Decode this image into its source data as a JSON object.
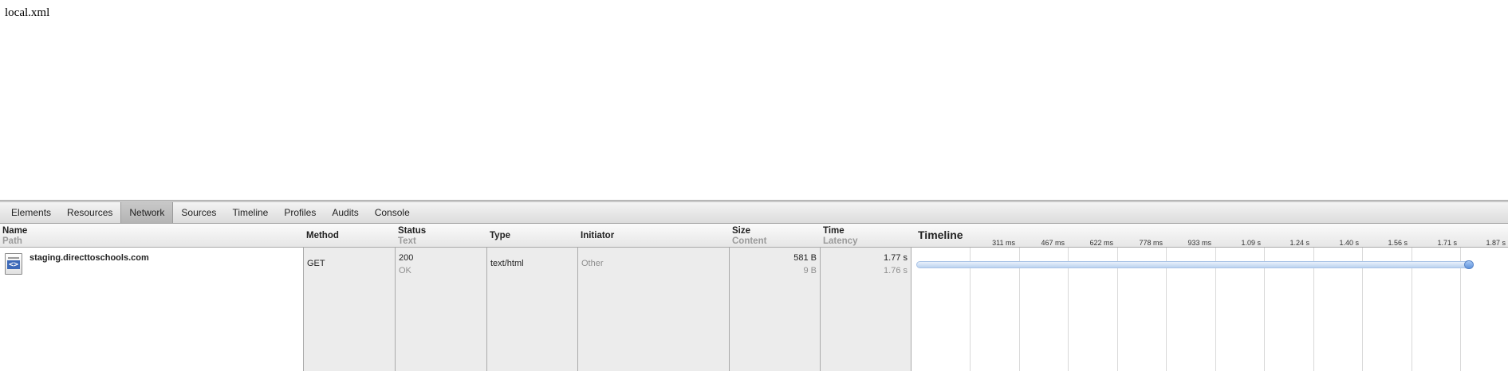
{
  "page": {
    "text": "local.xml"
  },
  "devtools": {
    "tabs": [
      {
        "label": "Elements",
        "active": false
      },
      {
        "label": "Resources",
        "active": false
      },
      {
        "label": "Network",
        "active": true
      },
      {
        "label": "Sources",
        "active": false
      },
      {
        "label": "Timeline",
        "active": false
      },
      {
        "label": "Profiles",
        "active": false
      },
      {
        "label": "Audits",
        "active": false
      },
      {
        "label": "Console",
        "active": false
      }
    ],
    "headers": {
      "name": {
        "title": "Name",
        "sub": "Path"
      },
      "method": {
        "title": "Method"
      },
      "status": {
        "title": "Status",
        "sub": "Text"
      },
      "type": {
        "title": "Type"
      },
      "initiator": {
        "title": "Initiator"
      },
      "size": {
        "title": "Size",
        "sub": "Content"
      },
      "time": {
        "title": "Time",
        "sub": "Latency"
      },
      "timeline": {
        "title": "Timeline"
      }
    },
    "ticks": [
      "311 ms",
      "467 ms",
      "622 ms",
      "778 ms",
      "933 ms",
      "1.09 s",
      "1.24 s",
      "1.40 s",
      "1.56 s",
      "1.71 s",
      "1.87 s"
    ],
    "request": {
      "name": "staging.directtoschools.com",
      "icon": "html-document-icon",
      "method": "GET",
      "status": "200",
      "status_text": "OK",
      "type": "text/html",
      "initiator": "Other",
      "size": "581 B",
      "content": "9 B",
      "time": "1.77 s",
      "latency": "1.76 s",
      "timeline_end_fraction": 0.947
    }
  }
}
